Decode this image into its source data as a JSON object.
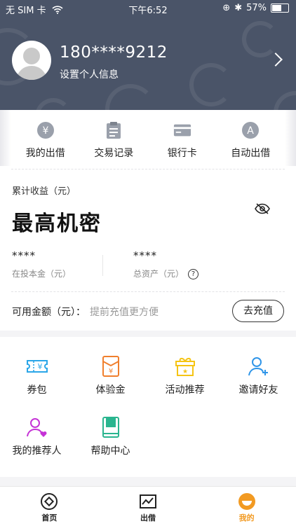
{
  "status_bar": {
    "carrier": "无 SIM 卡",
    "time": "下午6:52",
    "battery": "57%",
    "battery_level": 0.57
  },
  "profile": {
    "phone": "180****9212",
    "subtitle": "设置个人信息"
  },
  "quick_actions": [
    {
      "label": "我的出借",
      "icon": "yen-circle-icon"
    },
    {
      "label": "交易记录",
      "icon": "clipboard-icon"
    },
    {
      "label": "银行卡",
      "icon": "bank-card-icon"
    },
    {
      "label": "自动出借",
      "icon": "auto-a-icon"
    }
  ],
  "earnings": {
    "label": "累计收益（元）",
    "value": "最高机密",
    "principal_value": "****",
    "principal_label": "在投本金（元）",
    "assets_value": "****",
    "assets_label": "总资产（元）",
    "help_mark": "?"
  },
  "balance": {
    "label": "可用金额（元）：",
    "hint": "提前充值更方便",
    "recharge_label": "去充值"
  },
  "menu": [
    {
      "label": "券包",
      "icon": "coupon-icon",
      "color": "#2aa6e8"
    },
    {
      "label": "体验金",
      "icon": "red-envelope-icon",
      "color": "#f07f2d"
    },
    {
      "label": "活动推荐",
      "icon": "gift-icon",
      "color": "#f5c414"
    },
    {
      "label": "邀请好友",
      "icon": "add-user-icon",
      "color": "#2f95e8"
    },
    {
      "label": "我的推荐人",
      "icon": "referrer-icon",
      "color": "#c532d6"
    },
    {
      "label": "帮助中心",
      "icon": "help-book-icon",
      "color": "#2ab58f"
    }
  ],
  "tabs": [
    {
      "label": "首页",
      "icon": "home-icon"
    },
    {
      "label": "出借",
      "icon": "chart-icon"
    },
    {
      "label": "我的",
      "icon": "me-icon",
      "active": true
    }
  ],
  "colors": {
    "header": "#4a5468",
    "accent": "#f29a22"
  }
}
